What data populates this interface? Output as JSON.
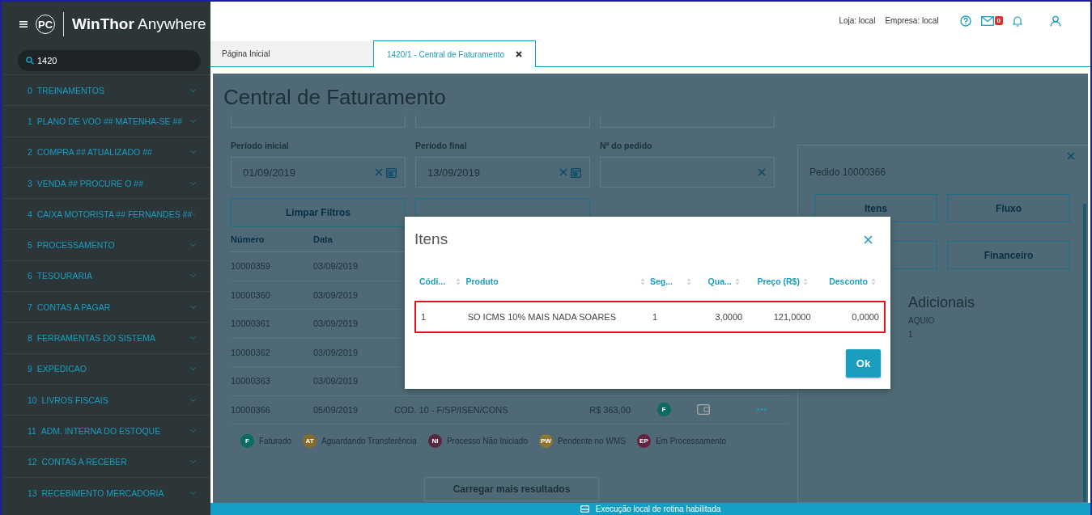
{
  "header": {
    "brand_mark": "PC",
    "brand_name": "WinThor",
    "brand_suffix": "Anywhere",
    "store": "Loja: local",
    "company": "Empresa: local",
    "mail_count": "0"
  },
  "sidebar": {
    "search_value": "1420",
    "items": [
      {
        "number": "0",
        "label": "TREINAMENTOS"
      },
      {
        "number": "1",
        "label": "PLANO DE VOO ## MATENHA-SE ##"
      },
      {
        "number": "2",
        "label": "COMPRA ## ATUALIZADO ##"
      },
      {
        "number": "3",
        "label": "VENDA ## PROCURE O ##"
      },
      {
        "number": "4",
        "label": "CAIXA MOTORISTA ## FERNANDES ##"
      },
      {
        "number": "5",
        "label": "PROCESSAMENTO"
      },
      {
        "number": "6",
        "label": "TESOURARIA"
      },
      {
        "number": "7",
        "label": "CONTAS A PAGAR"
      },
      {
        "number": "8",
        "label": "FERRAMENTAS DO SISTEMA"
      },
      {
        "number": "9",
        "label": "EXPEDICAO"
      },
      {
        "number": "10",
        "label": "LIVROS FISCAIS"
      },
      {
        "number": "11",
        "label": "ADM. INTERNA DO ESTOQUE"
      },
      {
        "number": "12",
        "label": "CONTAS A RECEBER"
      },
      {
        "number": "13",
        "label": "RECEBIMENTO MERCADORIA"
      }
    ]
  },
  "tabs": [
    {
      "label": "Página Inicial",
      "selected": false,
      "closable": false
    },
    {
      "label": "1420/1 - Central de Faturamento",
      "selected": true,
      "closable": true
    }
  ],
  "page": {
    "title": "Central de Faturamento",
    "filters": [
      {
        "label": "Período inicial",
        "value": "01/09/2019",
        "kind": "date"
      },
      {
        "label": "Período final",
        "value": "13/09/2019",
        "kind": "date"
      },
      {
        "label": "Nº do pedido",
        "kind": "text"
      }
    ],
    "clear_button": "Limpar Filtros",
    "columns": [
      "Número",
      "Data"
    ],
    "rows": [
      {
        "number": "10000359",
        "date": "03/09/2019"
      },
      {
        "number": "10000360",
        "date": "03/09/2019"
      },
      {
        "number": "10000361",
        "date": "03/09/2019"
      },
      {
        "number": "10000362",
        "date": "03/09/2019"
      },
      {
        "number": "10000363",
        "date": "03/09/2019"
      },
      {
        "number": "10000366",
        "date": "05/09/2019",
        "description": "COD. 10 - F/SP/ISEN/CONS",
        "total": "R$ 363,00",
        "status": "F",
        "color": "#0b6a62"
      }
    ],
    "legend": [
      {
        "badge": "F",
        "label": "Faturado",
        "color": "#0b6a62"
      },
      {
        "badge": "AT",
        "label": "Aguardando Transferência",
        "color": "#8a6a2c"
      },
      {
        "badge": "NI",
        "label": "Processo Não Iniciado",
        "color": "#5a2740"
      },
      {
        "badge": "PW",
        "label": "Pendente no WMS",
        "color": "#8c7630"
      },
      {
        "badge": "EP",
        "label": "Em Processamento",
        "color": "#62243f"
      }
    ],
    "load_more": "Carregar mais resultados"
  },
  "order_panel": {
    "title": "Pedido 10000366",
    "buttons": [
      {
        "label": "Itens"
      },
      {
        "label": "Fluxo"
      },
      {
        "label": "Financeiro"
      }
    ],
    "section_title": "Adicionais",
    "lines": [
      "AQUIO",
      "1"
    ]
  },
  "modal": {
    "title": "Itens",
    "columns": [
      {
        "label": "Códi..."
      },
      {
        "label": "Produto"
      },
      {
        "label": "Seg..."
      },
      {
        "label": "Qua..."
      },
      {
        "label": "Preço (R$)"
      },
      {
        "label": "Desconto"
      }
    ],
    "rows": [
      {
        "cells": [
          "1",
          "SO ICMS 10% MAIS NADA SOARES",
          "1",
          "3,0000",
          "121,0000",
          "0,0000"
        ],
        "highlighted": true
      }
    ],
    "ok": "Ok"
  },
  "status_bar": "Execução local de rotina habilitada"
}
